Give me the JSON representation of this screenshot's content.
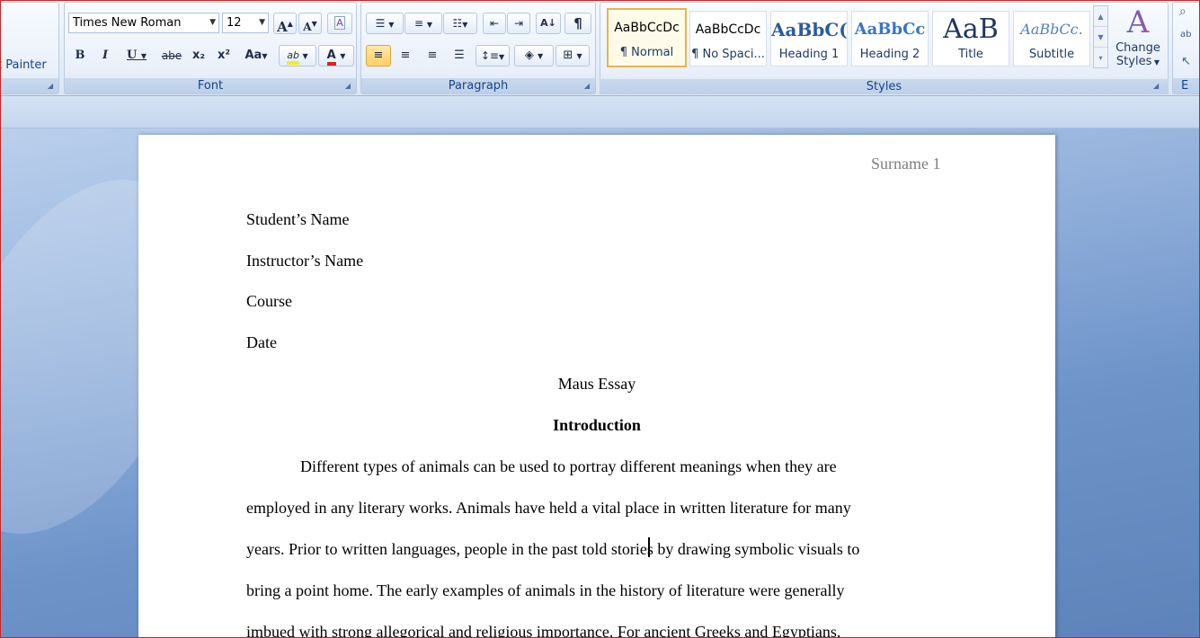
{
  "clipboard": {
    "format_painter_label": "t Painter"
  },
  "font": {
    "group_label": "Font",
    "family": "Times New Roman",
    "size": "12",
    "grow": "A",
    "shrink": "A",
    "clear_format": "A",
    "bold": "B",
    "italic": "I",
    "underline": "U",
    "strikethrough": "abe",
    "subscript": "x₂",
    "superscript": "x²",
    "change_case": "Aa",
    "highlight": "ab",
    "font_color": "A",
    "highlight_color": "#f5ea2b",
    "font_color_value": "#e0201b"
  },
  "paragraph": {
    "group_label": "Paragraph",
    "sort": "A↓",
    "pilcrow": "¶"
  },
  "styles": {
    "group_label": "Styles",
    "cards": [
      {
        "sample": "AaBbCcDc",
        "name": "¶ Normal"
      },
      {
        "sample": "AaBbCcDc",
        "name": "¶ No Spaci..."
      },
      {
        "sample": "AaBbC(",
        "name": "Heading 1"
      },
      {
        "sample": "AaBbCc",
        "name": "Heading 2"
      },
      {
        "sample": "AaB",
        "name": "Title"
      },
      {
        "sample": "AaBbCc.",
        "name": "Subtitle"
      }
    ],
    "change_styles_line1": "Change",
    "change_styles_line2": "Styles",
    "change_styles_icon": "A"
  },
  "editing": {
    "group_label_partial": "E"
  },
  "document": {
    "header": "Surname 1",
    "lines": [
      "Student’s Name",
      "Instructor’s Name",
      "Course",
      "Date"
    ],
    "title": "Maus Essay",
    "section_heading": "Introduction",
    "body": [
      "Different types of animals can be used to portray different meanings when they are",
      "employed in any literary works. Animals have held a vital place in written literature for many",
      "years. Prior to written languages, people in the past told stories by drawing symbolic visuals to",
      "bring a point home. The early examples of animals in the history of literature were generally",
      "imbued with strong allegorical and religious importance. For ancient Greeks and Egyptians,"
    ]
  }
}
